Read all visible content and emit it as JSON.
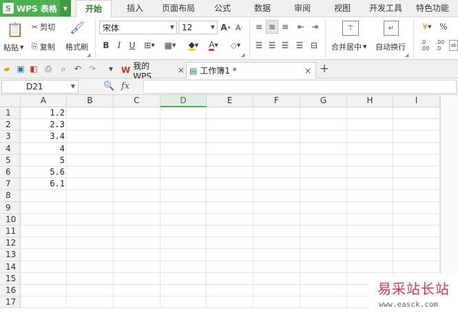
{
  "app": {
    "title": "WPS 表格",
    "logo": "S"
  },
  "menu": {
    "tabs": [
      "开始",
      "插入",
      "页面布局",
      "公式",
      "数据",
      "审阅",
      "视图",
      "开发工具",
      "特色功能"
    ],
    "active": "开始"
  },
  "ribbon": {
    "paste_label": "粘贴",
    "cut_label": "剪切",
    "copy_label": "复制",
    "format_painter_label": "格式刷",
    "font_name": "宋体",
    "font_size": "12",
    "bold": "B",
    "italic": "I",
    "underline": "U",
    "merge_label": "合并居中",
    "wrap_label": "自动换行",
    "percent": "%"
  },
  "doc_tabs": [
    {
      "label": "我的WPS",
      "active": false
    },
    {
      "label": "工作簿1 *",
      "active": true
    }
  ],
  "formula_bar": {
    "cell_ref": "D21",
    "fx": "fx",
    "value": ""
  },
  "sheet": {
    "columns": [
      "A",
      "B",
      "C",
      "D",
      "E",
      "F",
      "G",
      "H",
      "I"
    ],
    "selected_column": "D",
    "rows": [
      "1",
      "2",
      "3",
      "4",
      "5",
      "6",
      "7",
      "8",
      "9",
      "10",
      "11",
      "12",
      "13",
      "14",
      "15",
      "16",
      "17"
    ],
    "column_a_values": [
      "1.2",
      "2.3",
      "3.4",
      "4",
      "5",
      "5.6",
      "6.1"
    ]
  },
  "watermark": {
    "text": "易采站长站",
    "url": "www.easck.com"
  },
  "colors": {
    "brand": "#4caf50",
    "watermark": "#d9325f"
  }
}
